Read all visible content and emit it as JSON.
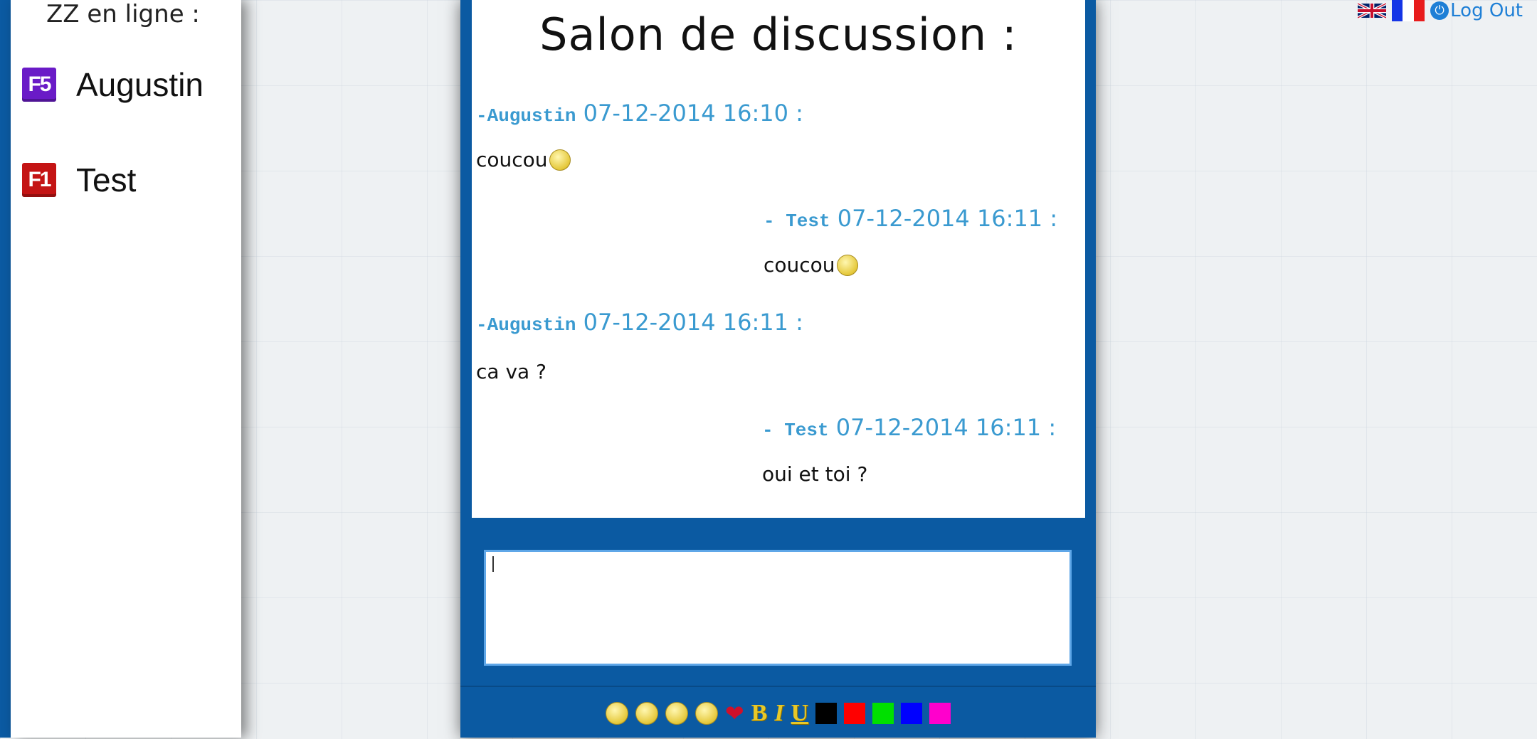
{
  "sidebar": {
    "title": "ZZ en ligne :",
    "users": [
      {
        "badge": "F5",
        "name": "Augustin",
        "color": "#6a1bc7"
      },
      {
        "badge": "F1",
        "name": "Test",
        "color": "#c41414"
      }
    ]
  },
  "chat": {
    "title": "Salon de discussion :",
    "messages": [
      {
        "author": "-Augustin",
        "date": "07-12-2014 16:10 :",
        "text": "coucou",
        "emoji": "neutral-smiley"
      },
      {
        "author": "- Test",
        "date": "07-12-2014 16:11 :",
        "text": "coucou",
        "emoji": "wink-smiley"
      },
      {
        "author": "-Augustin",
        "date": "07-12-2014 16:11 :",
        "text": "ca va ?"
      },
      {
        "author": "- Test",
        "date": "07-12-2014 16:11 :",
        "text": "oui et toi ?"
      }
    ]
  },
  "toolbar": {
    "emojis": [
      "neutral-smiley",
      "wink-smiley",
      "tongue-smiley",
      "sleepy-smiley",
      "heart"
    ],
    "format": {
      "bold": "B",
      "italic": "I",
      "underline": "U"
    },
    "colors": [
      "#000000",
      "#ff0000",
      "#00e000",
      "#0000ff",
      "#ff00cc"
    ]
  },
  "header": {
    "logout_label": "Log Out",
    "languages": [
      "en-flag",
      "fr-flag"
    ]
  },
  "theme": {
    "accent": "#0b5aa2",
    "author_color": "#3a9ad0"
  }
}
